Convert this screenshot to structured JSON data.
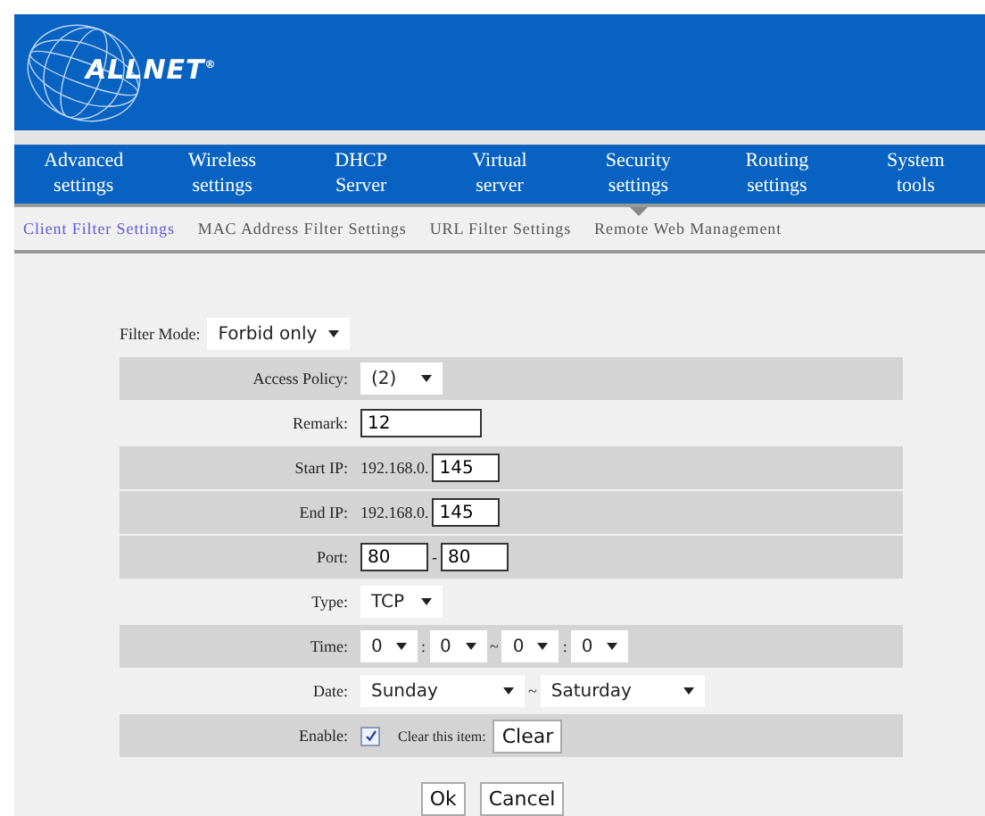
{
  "header": {
    "logo": "ALLNET",
    "logo_mark": "®"
  },
  "nav": [
    {
      "label": "Advanced settings",
      "selected": false
    },
    {
      "label": "Wireless settings",
      "selected": false
    },
    {
      "label": "DHCP Server",
      "selected": false
    },
    {
      "label": "Virtual server",
      "selected": false
    },
    {
      "label": "Security settings",
      "selected": true
    },
    {
      "label": "Routing settings",
      "selected": false
    },
    {
      "label": "System tools",
      "selected": false
    }
  ],
  "subnav": [
    {
      "label": "Client Filter Settings",
      "selected": true
    },
    {
      "label": "MAC Address Filter Settings",
      "selected": false
    },
    {
      "label": "URL Filter Settings",
      "selected": false
    },
    {
      "label": "Remote Web Management",
      "selected": false
    }
  ],
  "filter_mode": {
    "label": "Filter Mode:",
    "value": "Forbid only"
  },
  "rows": [
    {
      "kind": "select",
      "label": "Access Policy:",
      "shaded": true,
      "value": "(2)"
    },
    {
      "kind": "text",
      "label": "Remark:",
      "shaded": false,
      "value": "12"
    },
    {
      "kind": "ip",
      "label": "Start IP:",
      "shaded": true,
      "prefix": "192.168.0.",
      "value": "145"
    },
    {
      "kind": "ip",
      "label": "End IP:",
      "shaded": true,
      "prefix": "192.168.0.",
      "value": "145"
    },
    {
      "kind": "range",
      "label": "Port:",
      "shaded": true,
      "from": "80",
      "separator": "-",
      "to": "80"
    },
    {
      "kind": "select",
      "label": "Type:",
      "shaded": false,
      "value": "TCP"
    },
    {
      "kind": "time",
      "label": "Time:",
      "shaded": true,
      "values": [
        "0",
        "0",
        "0",
        "0"
      ],
      "separators": [
        ":",
        "~",
        ":"
      ]
    },
    {
      "kind": "date",
      "label": "Date:",
      "shaded": false,
      "from": "Sunday",
      "separator": "~",
      "to": "Saturday"
    },
    {
      "kind": "enable",
      "label": "Enable:",
      "shaded": true,
      "checked": true,
      "clear_label": "Clear this item:",
      "button": "Clear"
    }
  ],
  "buttons": [
    "Ok",
    "Cancel"
  ]
}
